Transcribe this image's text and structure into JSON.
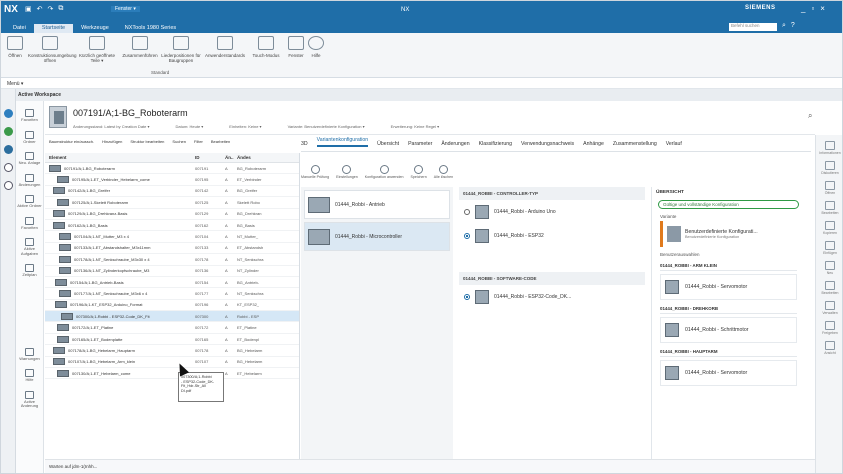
{
  "app": {
    "name": "NX",
    "title": "NX",
    "brand": "SIEMENS",
    "window_menu": "Fenster ▾",
    "search_placeholder": "Befehl suchen"
  },
  "menu_tabs": [
    "Datei",
    "Startseite",
    "Werkzeuge",
    "NXTools 1980 Series"
  ],
  "active_menu_tab": "Startseite",
  "ribbon": {
    "buttons": [
      "Öffnen",
      "Konstruktionsumgebung öffnen",
      "Kürzlich geöffnete Teile ▾",
      "Zusammenführen",
      "Liederpositionen für Baugruppen",
      "Anwenderstandards",
      "Touch-Modus",
      "Fenster",
      "Hilfe"
    ],
    "group": "Standard"
  },
  "menu_label": "Menü ▾",
  "workspace_title": "Active Workspace",
  "nav": [
    "Favoriten",
    "Ordner",
    "Neu. Anlage",
    "Änderungen",
    "Aktive Ordner",
    "Favoriten",
    "Aktive Aufgaben",
    "Zeitplan",
    "Warnungen",
    "Hilfe",
    "Active Änderung"
  ],
  "object": {
    "title": "007191/A;1-BG_Roboterarm",
    "meta": [
      "Änderungsstand: Latest by Creation Date ▾",
      "Datum: Heute ▾",
      "Einheiten: Keine ▾",
      "Variante: Benutzerdefinierte Konfiguration ▾",
      "Erweiterung: Keine Regel ▾"
    ]
  },
  "tree_toolbar": [
    "Baumstruktur ein/aussch.",
    "Hinzufügen",
    "Struktur bearbeiten",
    "Suchen",
    "Filter",
    "Bearbeiten"
  ],
  "tree_columns": [
    "Element",
    "ID",
    "Än..",
    "Ändes"
  ],
  "tree_rows": [
    {
      "name": "007191/A;1-BG_Roboterarm",
      "id": "007191",
      "rev": "A",
      "chg": "BG_Roboterarm"
    },
    {
      "name": "007195/A;1-ET_Verbinder_Hebelarm_come",
      "id": "007195",
      "rev": "A",
      "chg": "ET_Verbinder"
    },
    {
      "name": "007142/A;1-BG_Greifer",
      "id": "007142",
      "rev": "A",
      "chg": "BG_Greifer"
    },
    {
      "name": "007125/A;1-Skelett Roboterarm",
      "id": "007125",
      "rev": "A",
      "chg": "Skelett Robo"
    },
    {
      "name": "007129/A;1-BG_Drehkranz-Basis",
      "id": "007129",
      "rev": "A",
      "chg": "BG_Drehkran"
    },
    {
      "name": "007162/A;1-BG_Basis",
      "id": "007162",
      "rev": "A",
      "chg": "BG_Basis"
    },
    {
      "name": "007104/A;1-NT_Mutter_M3 x 4",
      "id": "007104",
      "rev": "A",
      "chg": "NT_Mutter_"
    },
    {
      "name": "007133/A;1-ET_Abstandshalter_M3x11mm",
      "id": "007133",
      "rev": "A",
      "chg": "ET_Abstandsh"
    },
    {
      "name": "007178/A;1-NT_Senkschraube_M3x30 x 4",
      "id": "007178",
      "rev": "A",
      "chg": "NT_Senkschra"
    },
    {
      "name": "007136/A;1-NT_Zylinderkopfschraube_M3",
      "id": "007136",
      "rev": "A",
      "chg": "NT_Zylinder"
    },
    {
      "name": "007154/A;1-BG_Antrieb-Basis",
      "id": "007154",
      "rev": "A",
      "chg": "BG_Antrieb-"
    },
    {
      "name": "007177/A;1-NT_Senkschraube_M3x6 x 4",
      "id": "007177",
      "rev": "A",
      "chg": "NT_Senkschra"
    },
    {
      "name": "007196/A;1-KT_ESP32_Arduino_Format",
      "id": "007196",
      "rev": "A",
      "chg": "KT_ESP32_"
    },
    {
      "name": "007300/A;1-Robbi - ESP32-Code_DK_Fit",
      "id": "007300",
      "rev": "A",
      "chg": "Robbi - ESP"
    },
    {
      "name": "007172/A;1-ET_Platine",
      "id": "007172",
      "rev": "A",
      "chg": "ET_Platine"
    },
    {
      "name": "007165/A;1-ET_Bodenplatte",
      "id": "007165",
      "rev": "A",
      "chg": "ET_Bodenpl"
    },
    {
      "name": "007178/A;1-BG_Hebelarm_Hauptarm",
      "id": "007178",
      "rev": "A",
      "chg": "BG_Hebelarm"
    },
    {
      "name": "007107/A;1-BG_Hebelarm_Arm_klein",
      "id": "007107",
      "rev": "A",
      "chg": "BG_Hebelarm"
    },
    {
      "name": "007130/A;1-ET_Hebelarm_come",
      "id": "007130",
      "rev": "A",
      "chg": "ET_Hebelarm"
    }
  ],
  "tooltip": "007300/A;1-Robbi\n- ESP32-Code_DK-\nFit_Hdr-Str_All\nDI.pdf",
  "status": "Warten auf jdm-1(Inhh...",
  "tabs": [
    "3D",
    "Variantenkonfiguration",
    "Übersicht",
    "Parameter",
    "Änderungen",
    "Klassifizierung",
    "Verwendungsnachweis",
    "Anhänge",
    "Zusammenstellung",
    "Verlauf"
  ],
  "active_tab": "Variantenkonfiguration",
  "variant_tools": [
    "Manuelle Prüfung",
    "Einstellungen",
    "Konfiguration anwenden",
    "Speichern",
    "Alle löschen"
  ],
  "features": [
    {
      "label": "01444_Robbi - Antrieb",
      "selected": false
    },
    {
      "label": "01444_Robbi - Microcontroller",
      "selected": true
    }
  ],
  "options": {
    "groups": [
      {
        "title": "01444_ROBBI - CONTROLLER-TYP",
        "items": [
          {
            "label": "01444_Robbi - Arduino Uno",
            "selected": false
          },
          {
            "label": "01444_Robbi - ESP32",
            "selected": true
          }
        ]
      },
      {
        "title": "01444_ROBBI - SOFTWARE-CODE",
        "items": [
          {
            "label": "01444_Robbi - ESP32-Code_DK...",
            "selected": true
          }
        ]
      }
    ]
  },
  "overview": {
    "title": "ÜBERSICHT",
    "status": "Gültige und vollständige Konfiguration",
    "variant_label": "Variante",
    "variant_name": "Benutzerdefinierte Konfigurati...",
    "variant_sub": "Benutzerdefinierte Konfiguration",
    "selections_label": "Benutzerauswahlen",
    "sections": [
      {
        "title": "01444_ROBBI - ARM KLEIN",
        "item": "01444_Robbi - Servomotor"
      },
      {
        "title": "01444_ROBBI - DREHKORB",
        "item": "01444_Robbi - Schrittmotor"
      },
      {
        "title": "01444_ROBBI - HAUPTARM",
        "item": "01444_Robbi - Servomotor"
      }
    ]
  },
  "right_tools": [
    "Informationen",
    "Diskutieren",
    "Öffnen",
    "Bearbeiten",
    "Kopieren",
    "Einfügen",
    "Neu",
    "Bearbeiten",
    "Verwalten",
    "Freigeben",
    "Ansicht"
  ]
}
